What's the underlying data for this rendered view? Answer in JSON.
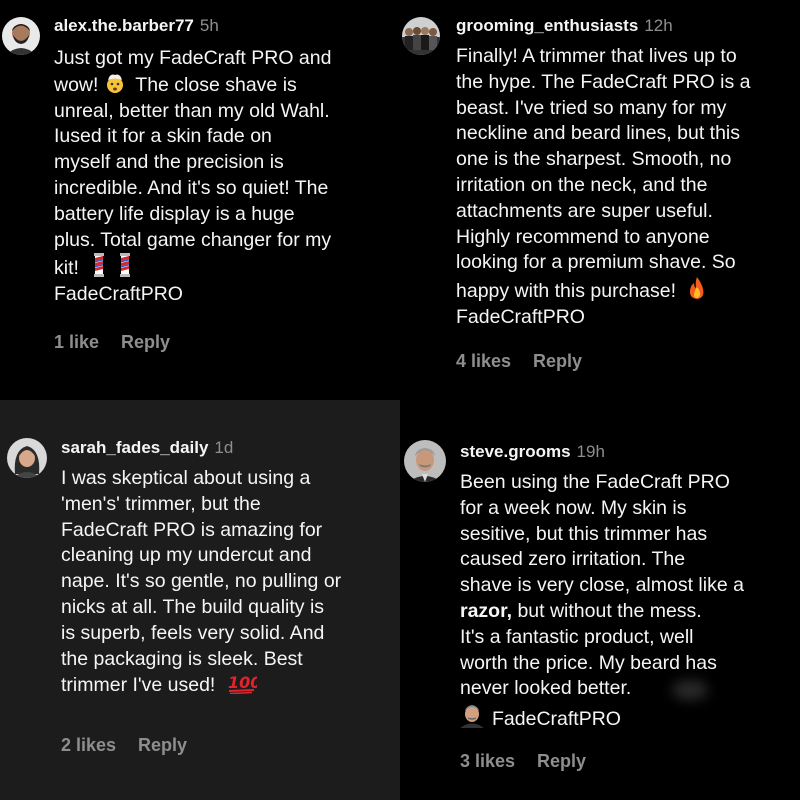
{
  "comments": [
    {
      "username": "alex.the.barber77",
      "time": "5h",
      "lines": [
        "Just got my FadeCraft PRO and",
        "The close shave is",
        "unreal, better than my old Wahl.",
        "Iused it for a skin fade on",
        "myself and the precision is",
        "incredible. And it's so quiet! The",
        "battery life display is a huge",
        "plus. Total game changer for my",
        "kit!",
        "FadeCraftPRO"
      ],
      "line2_prefix": "wow!",
      "likes": "1 like",
      "reply": "Reply",
      "avatar_icon": "man-beard-avatar",
      "emojis": [
        "exploding-head-emoji",
        "barber-pole-emoji",
        "barber-pole-emoji"
      ]
    },
    {
      "username": "grooming_enthusiasts",
      "time": "12h",
      "lines": [
        "Finally! A trimmer that lives up to",
        "the hype. The FadeCraft PRO is a",
        "beast. I've tried so many for my",
        "neckline and beard lines, but this",
        "one is the sharpest. Smooth, no",
        "irritation on the neck, and the",
        "attachments are super useful.",
        "Highly recommend to anyone",
        "looking for a premium shave. So",
        "happy with this purchase!",
        "FadeCraftPRO"
      ],
      "likes": "4 likes",
      "reply": "Reply",
      "avatar_icon": "group-photo-avatar",
      "emojis": [
        "fire-emoji"
      ]
    },
    {
      "username": "sarah_fades_daily",
      "time": "1d",
      "lines": [
        "I was skeptical about using a",
        "'men's' trimmer, but the",
        "FadeCraft PRO is amazing for",
        "cleaning up my undercut and",
        "nape. It's so gentle, no pulling or",
        "nicks at all. The build quality is",
        "is superb, feels very solid. And",
        "the packaging is sleek. Best",
        "trimmer I've used!"
      ],
      "likes": "2 likes",
      "reply": "Reply",
      "avatar_icon": "woman-avatar",
      "emojis": [
        "hundred-points-emoji"
      ]
    },
    {
      "username": "steve.grooms",
      "time": "19h",
      "lines": [
        "Been using the FadeCraft PRO",
        "for a week now. My skin is",
        "sesitive, but this trimmer has",
        "caused zero irritation. The",
        "shave is very close, almost like a",
        "but without the mess.",
        "It's a fantastic product, well",
        "worth the price. My beard has",
        "never looked better.",
        "FadeCraftPRO"
      ],
      "bold_word": "razor,",
      "likes": "3 likes",
      "reply": "Reply",
      "avatar_icon": "older-man-avatar",
      "emojis": [
        "man-face-emoji"
      ]
    }
  ]
}
